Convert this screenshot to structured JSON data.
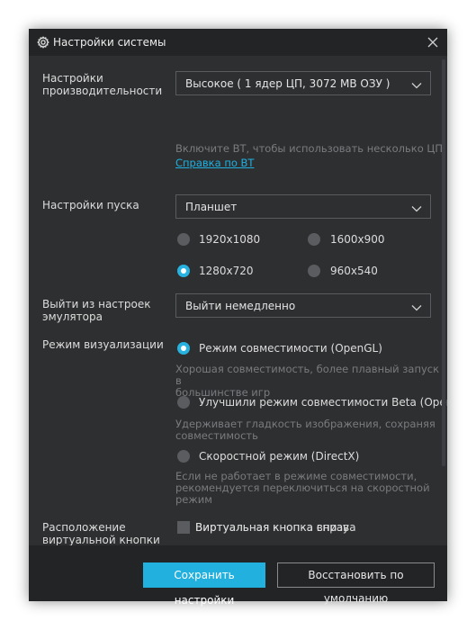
{
  "window": {
    "title": "Настройки системы",
    "title_icon": "gear-icon",
    "close_icon": "close-icon"
  },
  "performance": {
    "label_line1": "Настройки",
    "label_line2": "производительности",
    "value": "Высокое ( 1 ядер ЦП, 3072 MB ОЗУ )",
    "hint": "Включите ВТ, чтобы использовать несколько ЦП.",
    "link": "Справка по ВТ"
  },
  "startup": {
    "label": "Настройки пуска",
    "value": "Планшет",
    "resolutions": [
      {
        "label": "1920x1080",
        "selected": false
      },
      {
        "label": "1600x900",
        "selected": false
      },
      {
        "label": "1280x720",
        "selected": true
      },
      {
        "label": "960x540",
        "selected": false
      }
    ]
  },
  "exit": {
    "label_line1": "Выйти из настроек",
    "label_line2": "эмулятора",
    "value": "Выйти немедленно"
  },
  "render": {
    "label": "Режим визуализации",
    "options": [
      {
        "label": "Режим совместимости (OpenGL)",
        "selected": true,
        "desc_line1": "Хорошая совместимость, более плавный запуск в",
        "desc_line2": "большинстве игр"
      },
      {
        "label": "Улучшили режим совместимости Beta (OpenGL",
        "selected": false,
        "desc_line1": "Удерживает гладкость изображения, сохраняя",
        "desc_line2": "совместимость"
      },
      {
        "label": "Скоростной режим (DirectX)",
        "selected": false,
        "desc_line1": "Если не работает в режиме совместимости,",
        "desc_line2": "рекомендуется переключиться на скоростной",
        "desc_line3": "режим"
      }
    ]
  },
  "virtual_button": {
    "label_line1": "Расположение",
    "label_line2": "виртуальной кнопки",
    "options": [
      {
        "label": "Виртуальная кнопка справа",
        "checked": true
      },
      {
        "label": "Виртуальная кнопка внизу",
        "checked": false
      }
    ]
  },
  "footer": {
    "save": "Сохранить настройки",
    "restore": "Восстановить по умолчанию"
  },
  "colors": {
    "accent": "#22b0de",
    "dialog_bg": "#2e2f31",
    "titlebar_bg": "#232426"
  }
}
